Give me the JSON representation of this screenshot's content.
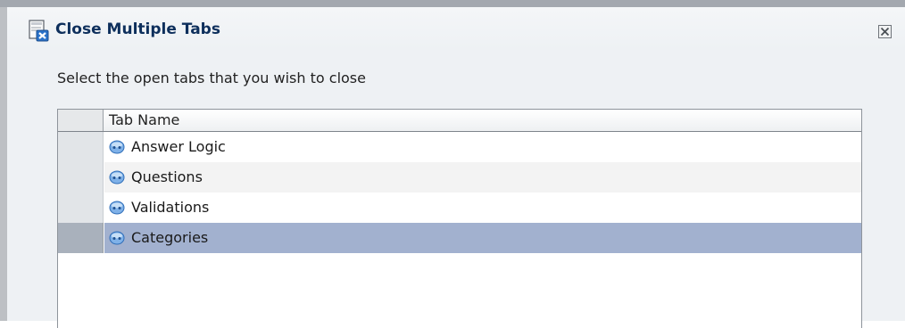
{
  "dialog": {
    "title": "Close Multiple Tabs",
    "instruction": "Select the open tabs that you wish to close",
    "title_icon": "close-tab-document-icon",
    "close_icon": "close-x-icon"
  },
  "table": {
    "column_header": "Tab Name",
    "row_icon": "question-bubble-icon",
    "rows": [
      {
        "label": "Answer Logic",
        "selected": false
      },
      {
        "label": "Questions",
        "selected": false
      },
      {
        "label": "Validations",
        "selected": false
      },
      {
        "label": "Categories",
        "selected": true
      }
    ]
  },
  "colors": {
    "title_text": "#0e2f5c",
    "selected_row": "#a2b1cf",
    "dialog_bg": "#eef1f4"
  }
}
